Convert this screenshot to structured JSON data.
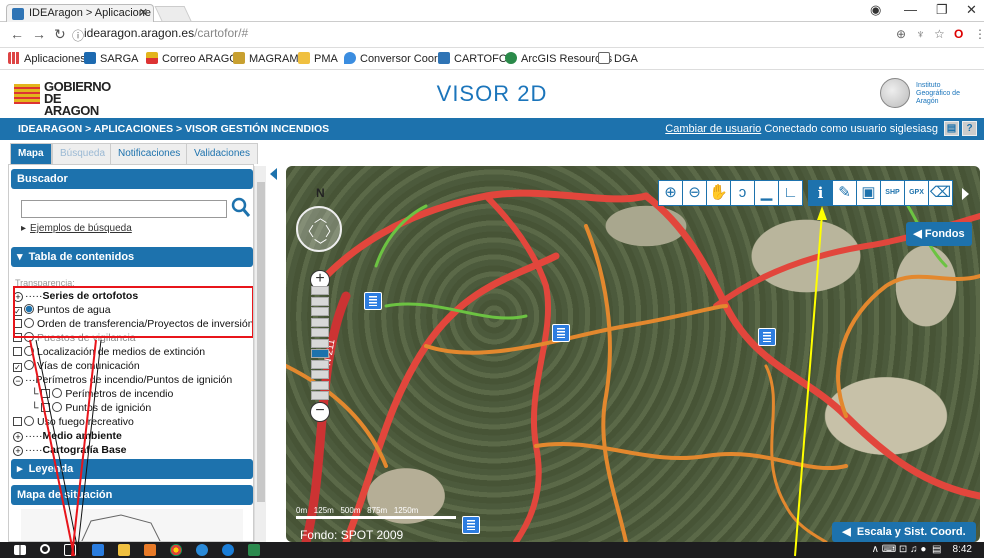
{
  "browser": {
    "tab_title": "IDEAragon > Aplicacione",
    "url_host": "idearagon.aragon.es",
    "url_path": "/cartofor/#",
    "bookmarks": [
      "Aplicaciones",
      "SARGA",
      "Correo ARAGON",
      "MAGRAMA",
      "PMA",
      "Conversor Coord",
      "CARTOFOR",
      "ArcGIS Resources",
      "DGA"
    ]
  },
  "header": {
    "left_logo_line1": "GOBIERNO",
    "left_logo_line2": "DE ARAGON",
    "title": "VISOR 2D",
    "right_logo_line1": "Instituto",
    "right_logo_line2": "Geográfico de",
    "right_logo_line3": "Aragón"
  },
  "bluebar": {
    "breadcrumb": "IDEARAGON > APLICACIONES > VISOR GESTIÓN INCENDIOS",
    "change_user": "Cambiar de usuario",
    "connected_as": "Conectado como usuario siglesiasg"
  },
  "tabs": [
    {
      "label": "Mapa",
      "state": "active"
    },
    {
      "label": "Búsqueda",
      "state": "disabled"
    },
    {
      "label": "Notificaciones",
      "state": "normal"
    },
    {
      "label": "Validaciones",
      "state": "normal"
    }
  ],
  "sidebar": {
    "buscador_title": "Buscador",
    "examples_link": "Ejemplos de búsqueda",
    "toc_title": "Tabla de contenidos",
    "transparency_label": "Transparencia:",
    "toc_items": [
      "Series de ortofotos",
      "Puntos de agua",
      "Orden de transferencia/Proyectos de inversión",
      "Puestos de vigilancia",
      "Localización de medios de extinción",
      "Vías de comunicación",
      "Perímetros de incendio/Puntos de ignición",
      "Perímetros de incendio",
      "Puntos de ignición",
      "Uso fuego recreativo",
      "Medio ambiente",
      "Cartografía Base"
    ],
    "leyenda_title": "Leyenda",
    "situacion_title": "Mapa de situación"
  },
  "map": {
    "fondos_label": "Fondos",
    "escala_label": "Escala y Sist. Coord.",
    "fondo_label": "Fondo: SPOT 2009",
    "scale_labels": [
      "0m",
      "125m",
      "500m",
      "875m",
      "1250m"
    ],
    "north_label": "N",
    "road_label": "N-211",
    "tools": [
      "zoom-in",
      "zoom-out",
      "pan",
      "lasso",
      "measure-distance",
      "measure-area",
      "info",
      "draw",
      "save",
      "shp",
      "gpx",
      "erase"
    ],
    "selected_tool": "info",
    "tool_text_shp": "SHP",
    "tool_text_gpx": "GPX",
    "zoom_level_fraction": 0.4
  },
  "taskbar": {
    "clock": "8:42"
  },
  "colors": {
    "accent": "#1d72ad",
    "annotation_red": "#e8151b",
    "annotation_yellow": "#ffff00"
  }
}
